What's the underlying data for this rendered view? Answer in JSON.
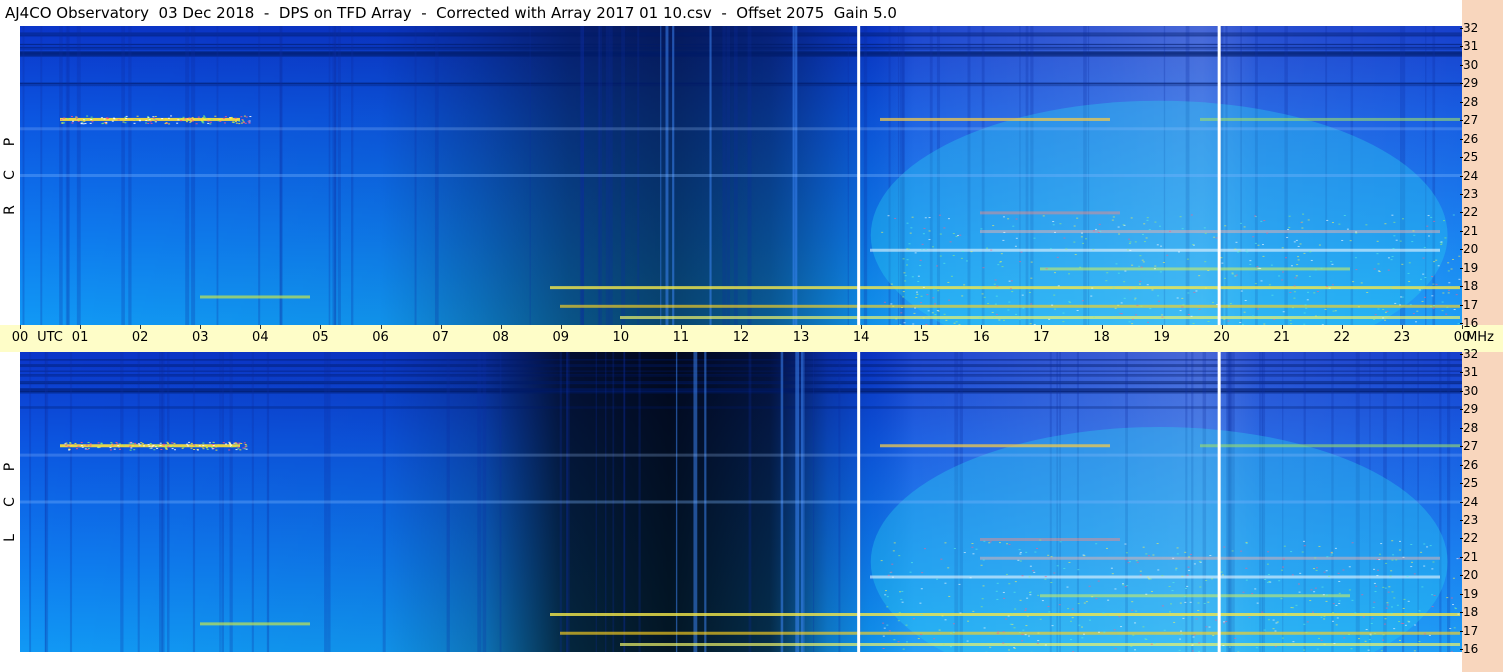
{
  "title": "AJ4CO Observatory  03 Dec 2018  -  DPS on TFD Array  -  Corrected with Array 2017 01 10.csv  -  Offset 2075  Gain 5.0",
  "chart_data": [
    {
      "type": "heatmap",
      "panel": "top",
      "polarization": [
        "R",
        "C",
        "P"
      ],
      "x_axis": {
        "unit": "UTC",
        "range": [
          0,
          24
        ]
      },
      "y_axis": {
        "unit": "MHz",
        "range": [
          16,
          32
        ]
      },
      "bright_bands_mhz": [
        27,
        18,
        17,
        16.5,
        20,
        21
      ]
    },
    {
      "type": "heatmap",
      "panel": "bottom",
      "polarization": [
        "L",
        "C",
        "P"
      ],
      "x_axis": {
        "unit": "UTC",
        "range": [
          0,
          24
        ]
      },
      "y_axis": {
        "unit": "MHz",
        "range": [
          16,
          32
        ]
      },
      "bright_bands_mhz": [
        27,
        18,
        17,
        16.5,
        20,
        21
      ]
    }
  ],
  "time_axis": {
    "labels": [
      "00",
      "UTC",
      "01",
      "02",
      "03",
      "04",
      "05",
      "06",
      "07",
      "08",
      "09",
      "10",
      "11",
      "12",
      "13",
      "14",
      "15",
      "16",
      "17",
      "18",
      "19",
      "20",
      "21",
      "22",
      "23",
      "00",
      "MHz"
    ]
  },
  "freq_axis": {
    "labels": [
      "32",
      "31",
      "30",
      "29",
      "28",
      "27",
      "26",
      "25",
      "24",
      "23",
      "22",
      "21",
      "20",
      "19",
      "18",
      "17",
      "16"
    ]
  },
  "colors": {
    "axis_band": "#fefdc8",
    "right_strip": "#f8d6bd",
    "background_low": "#0a3ad8",
    "background_high": "#18b6f0",
    "hot": "#ffea3a"
  }
}
